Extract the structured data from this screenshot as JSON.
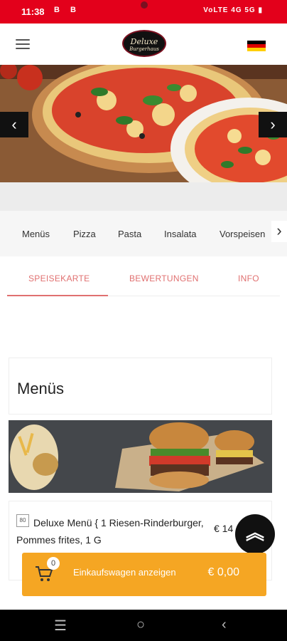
{
  "status_bar": {
    "time": "11:38",
    "left_icons": "B B",
    "right_icons": "VoLTE 4G 5G ▮"
  },
  "header": {
    "logo_line1": "Deluxe",
    "logo_line2": "Burgerhaus",
    "menu_icon": "hamburger-icon",
    "language_icon": "german-flag-icon"
  },
  "hero": {
    "prev_icon": "chevron-left-icon",
    "next_icon": "chevron-right-icon"
  },
  "categories": {
    "items": [
      "Menüs",
      "Pizza",
      "Pasta",
      "Insalata",
      "Vorspeisen"
    ],
    "next_icon": "chevron-right-icon"
  },
  "tabs": {
    "items": [
      "SPEISEKARTE",
      "BEWERTUNGEN",
      "INFO"
    ],
    "active": "SPEISEKARTE"
  },
  "section": {
    "title": "Menüs"
  },
  "item": {
    "icon_label": "80",
    "name": "Deluxe Menü { 1 Riesen-Rinderburger, Pommes frites, 1 G",
    "price": "€ 14"
  },
  "scroll_top_icon": "double-chevron-up-icon",
  "cart": {
    "count": "0",
    "label": "Einkaufswagen anzeigen",
    "total": "€ 0,00",
    "icon": "shopping-cart-icon"
  },
  "colors": {
    "status_bar": "#e3001b",
    "tab_accent": "#e07070",
    "cart_bar": "#f5a623"
  }
}
